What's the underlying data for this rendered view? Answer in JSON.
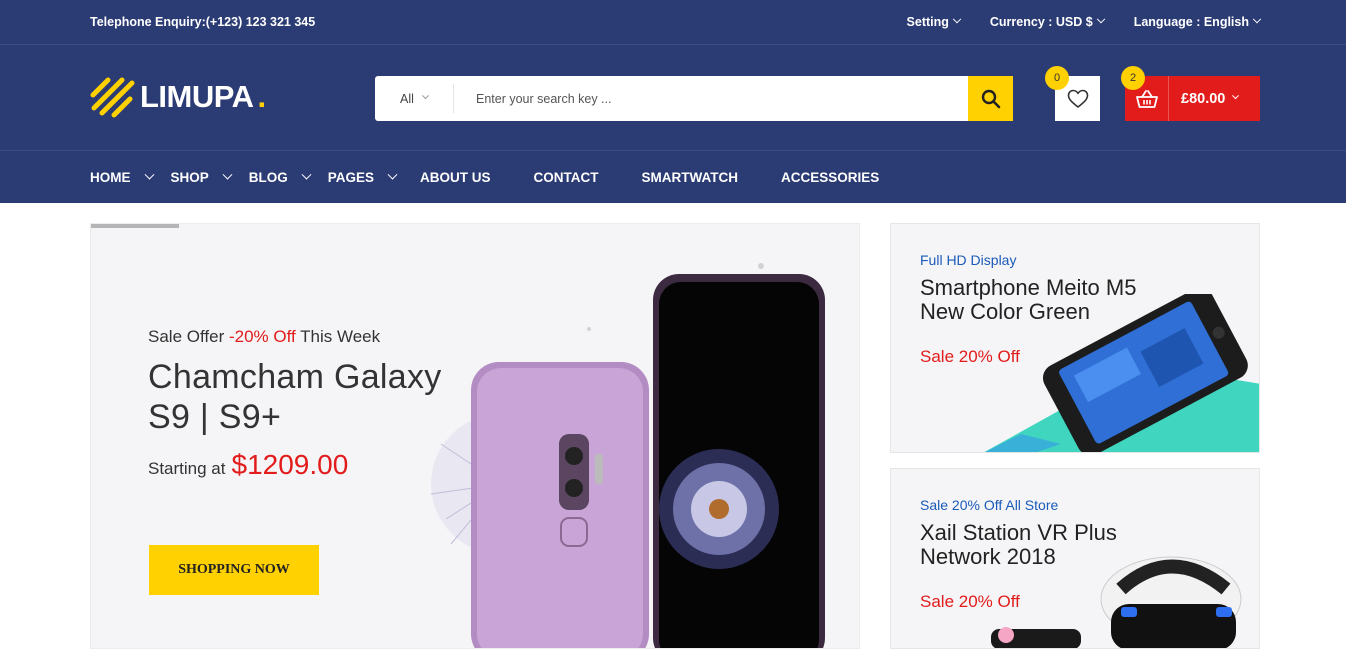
{
  "topbar": {
    "phone": "Telephone Enquiry:(+123) 123 321 345",
    "links": [
      {
        "label": "Setting"
      },
      {
        "label": "Currency : USD $"
      },
      {
        "label": "Language : English"
      }
    ]
  },
  "header": {
    "logo_text": "LIMUPA",
    "logo_dot": ".",
    "search": {
      "category": "All",
      "placeholder": "Enter your search key ..."
    },
    "wishlist_count": "0",
    "cart_count": "2",
    "cart_total": "£80.00"
  },
  "nav": {
    "items": [
      {
        "label": "HOME",
        "dropdown": true
      },
      {
        "label": "SHOP",
        "dropdown": true
      },
      {
        "label": "BLOG",
        "dropdown": true
      },
      {
        "label": "PAGES",
        "dropdown": true
      },
      {
        "label": "ABOUT US",
        "dropdown": false
      },
      {
        "label": "CONTACT",
        "dropdown": false
      },
      {
        "label": "SMARTWATCH",
        "dropdown": false
      },
      {
        "label": "ACCESSORIES",
        "dropdown": false
      }
    ]
  },
  "hero": {
    "offer_prefix": "Sale Offer ",
    "offer_highlight": "-20% Off",
    "offer_suffix": " This Week",
    "title": "Chamcham Galaxy S9 | S9+",
    "price_prefix": "Starting at",
    "price": "$1209.00",
    "cta": "SHOPPING NOW"
  },
  "side_banners": [
    {
      "kicker": "Full HD Display",
      "title": "Smartphone Meito M5 New Color Green",
      "sale": "Sale 20% Off"
    },
    {
      "kicker": "Sale 20% Off All Store",
      "title": "Xail Station VR Plus Network 2018",
      "sale": "Sale 20% Off"
    }
  ],
  "colors": {
    "brand_navy": "#2b3b73",
    "accent_yellow": "#ffd100",
    "accent_red": "#e21b1b",
    "kicker_blue": "#1a5ab8"
  },
  "icons": [
    "logo-stripes-icon",
    "search-icon",
    "heart-icon",
    "basket-icon",
    "chevron-down-icon"
  ]
}
